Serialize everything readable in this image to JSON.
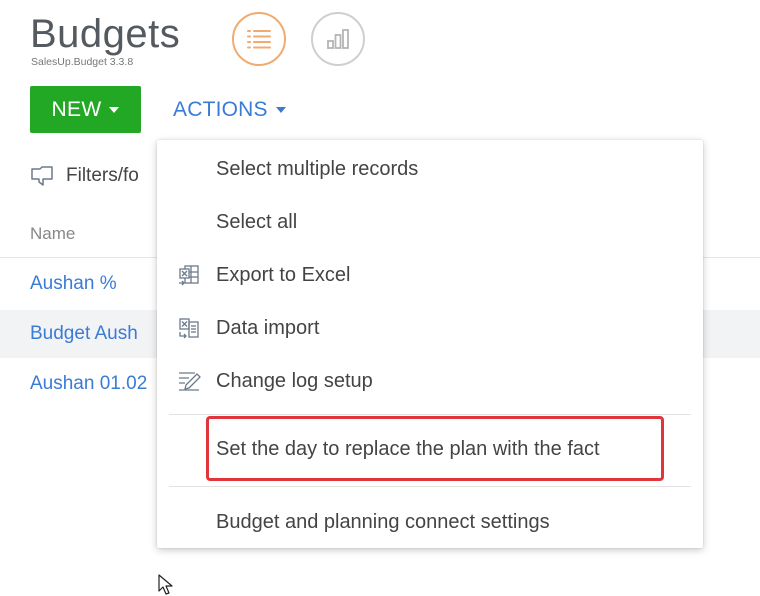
{
  "header": {
    "title": "Budgets",
    "subtitle": "SalesUp.Budget 3.3.8",
    "view_list_icon": "list-view-icon",
    "view_chart_icon": "chart-view-icon"
  },
  "toolbar": {
    "new_label": "NEW",
    "actions_label": "ACTIONS",
    "new_color": "#22a825",
    "actions_color": "#3a7bd5"
  },
  "filters": {
    "label": "Filters/fo",
    "icon": "filter-icon"
  },
  "list": {
    "column_header": "Name",
    "rows": [
      {
        "name": "Aushan %",
        "selected": false
      },
      {
        "name": "Budget Aush",
        "selected": true
      },
      {
        "name": "Aushan 01.02",
        "selected": false
      }
    ]
  },
  "actions_menu": {
    "items": [
      {
        "label": "Select multiple records",
        "icon": ""
      },
      {
        "label": "Select all",
        "icon": ""
      },
      {
        "label": "Export to Excel",
        "icon": "excel-export-icon"
      },
      {
        "label": "Data import",
        "icon": "data-import-icon"
      },
      {
        "label": "Change log setup",
        "icon": "change-log-icon"
      },
      {
        "label": "Set the day to replace the plan with the fact",
        "icon": "",
        "highlighted": true
      },
      {
        "label": "Budget and planning connect settings",
        "icon": ""
      }
    ],
    "highlight_color": "#e0353b"
  }
}
